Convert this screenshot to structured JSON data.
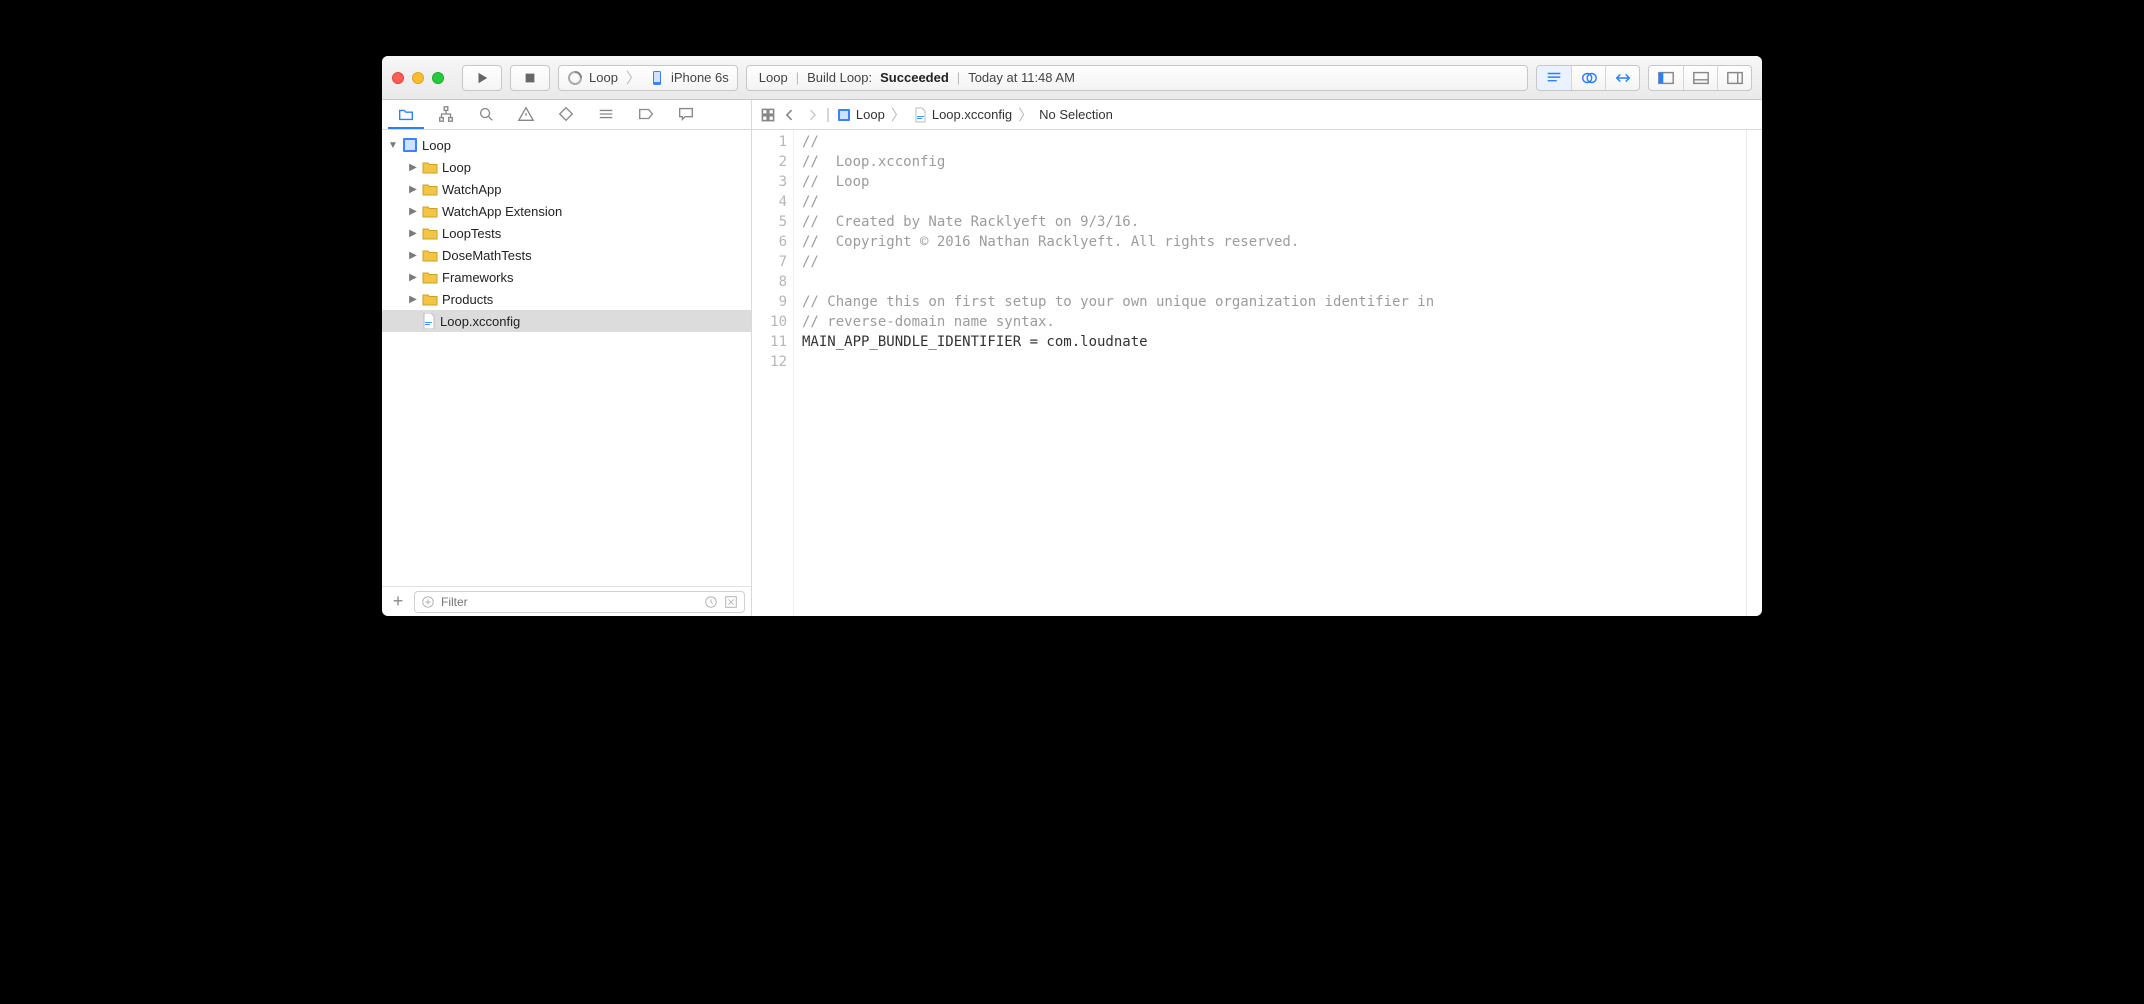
{
  "toolbar": {
    "scheme_target": "Loop",
    "scheme_device": "iPhone 6s",
    "status_app": "Loop",
    "status_action": "Build Loop:",
    "status_result": "Succeeded",
    "status_time": "Today at 11:48 AM"
  },
  "breadcrumb": {
    "root": "Loop",
    "file": "Loop.xcconfig",
    "tail": "No Selection"
  },
  "project": {
    "name": "Loop",
    "folders": [
      {
        "name": "Loop"
      },
      {
        "name": "WatchApp"
      },
      {
        "name": "WatchApp Extension"
      },
      {
        "name": "LoopTests"
      },
      {
        "name": "DoseMathTests"
      },
      {
        "name": "Frameworks"
      },
      {
        "name": "Products"
      }
    ],
    "selected_file": "Loop.xcconfig"
  },
  "filter": {
    "placeholder": "Filter"
  },
  "code": {
    "lines": [
      {
        "n": 1,
        "type": "comment",
        "text": "//"
      },
      {
        "n": 2,
        "type": "comment",
        "text": "//  Loop.xcconfig"
      },
      {
        "n": 3,
        "type": "comment",
        "text": "//  Loop"
      },
      {
        "n": 4,
        "type": "comment",
        "text": "//"
      },
      {
        "n": 5,
        "type": "comment",
        "text": "//  Created by Nate Racklyeft on 9/3/16."
      },
      {
        "n": 6,
        "type": "comment",
        "text": "//  Copyright © 2016 Nathan Racklyeft. All rights reserved."
      },
      {
        "n": 7,
        "type": "comment",
        "text": "//"
      },
      {
        "n": 8,
        "type": "blank",
        "text": ""
      },
      {
        "n": 9,
        "type": "comment",
        "text": "// Change this on first setup to your own unique organization identifier in"
      },
      {
        "n": 10,
        "type": "comment",
        "text": "// reverse-domain name syntax."
      },
      {
        "n": 11,
        "type": "code",
        "text": "MAIN_APP_BUNDLE_IDENTIFIER = com.loudnate"
      },
      {
        "n": 12,
        "type": "blank",
        "text": ""
      }
    ]
  }
}
